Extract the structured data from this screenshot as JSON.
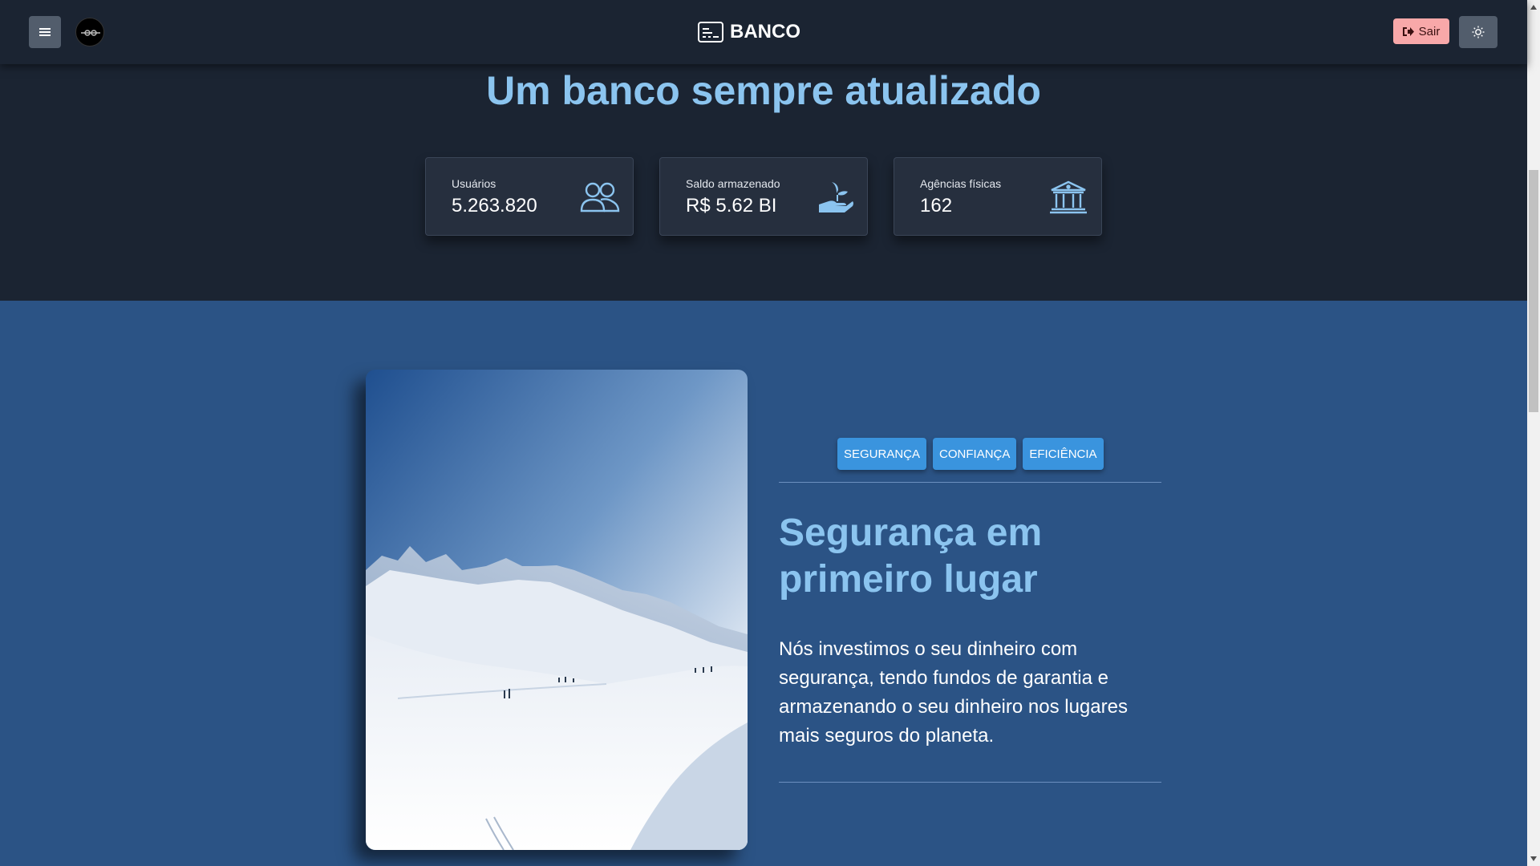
{
  "header": {
    "brand_label": "BANCO",
    "logout_label": "Sair",
    "menu_icon": "hamburger-icon",
    "theme_icon": "sun-icon"
  },
  "stats": {
    "title": "Um banco sempre atualizado",
    "cards": [
      {
        "label": "Usuários",
        "value": "5.263.820",
        "icon": "users-icon"
      },
      {
        "label": "Saldo armazenado",
        "value": "R$ 5.62 BI",
        "icon": "hand-seedling-icon"
      },
      {
        "label": "Agências físicas",
        "value": "162",
        "icon": "bank-icon"
      }
    ]
  },
  "feature": {
    "tabs": [
      "SEGURANÇA",
      "CONFIANÇA",
      "EFICIÊNCIA"
    ],
    "title": "Segurança em primeiro lugar",
    "text": "Nós investimos o seu dinheiro com segurança, tendo fundos de garantia e armazenando o seu dinheiro nos lugares mais seguros do planeta."
  },
  "colors": {
    "nav_bg": "#1b2432",
    "section_bg": "#2b5385",
    "accent_title": "#8bc4ef",
    "tab_bg": "#3a94de",
    "logout_bg": "#f8a8a9"
  }
}
